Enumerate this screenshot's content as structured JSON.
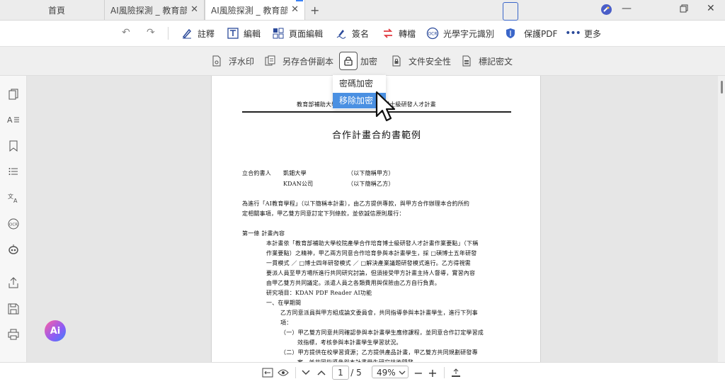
{
  "tabs": [
    {
      "label": "首頁"
    },
    {
      "label": "AI風險探測 _ 教育部補助..."
    },
    {
      "label": "AI風險探測 _ 教育部補助..."
    }
  ],
  "toolbar": {
    "annotate": "註釋",
    "edit": "編輯",
    "page_edit": "頁面編輯",
    "sign": "簽名",
    "convert": "轉檔",
    "ocr": "光學字元識別",
    "protect": "保護PDF",
    "more": "更多"
  },
  "subbar": {
    "watermark": "浮水印",
    "save_merge": "另存合併副本",
    "encrypt": "加密",
    "doc_security": "文件安全性",
    "redact": "標記密文"
  },
  "dropdown": {
    "items": [
      "密碼加密",
      "移除加密"
    ],
    "highlighted": "移除加密"
  },
  "document": {
    "header": "教育部補助大學校院產學合作培育博士級研發人才計畫",
    "title": "合作計畫合約書範例",
    "party_label": "立合約書人",
    "party1_name": "凱鈿大學",
    "party1_alias": "（以下簡稱甲方）",
    "party2_name": "KDAN公司",
    "party2_alias": "（以下簡稱乙方）",
    "intro_1": "為進行「AI教育學程」（以下簡稱本計畫），由乙方提供專款，與甲方合作辦理本合約所約",
    "intro_2": "定相關事項，甲乙雙方同意訂定下列條款，並依誠信原則履行：",
    "art1_title": "第一條  計畫內容",
    "art1_l1": "本計畫依「教育部補助大學校院產學合作培育博士級研發人才計畫作業要點」（下稱",
    "art1_l2": "作業要點）之精神，甲乙兩方同意合作培育參與本計畫學生，採 □碩博士五年研發",
    "art1_l3": "一貫模式 ／ □博士四年研發模式 ／ □解決產業議題研發模式進行。乙方得視需",
    "art1_l4": "要派人員至甲方場所進行共同研究討論，但須接受甲方計畫主持人督導，實習內容",
    "art1_l5": "由甲乙雙方共同議定。派遣人員之各類費用與保險由乙方自行負責。",
    "art1_project": "研究項目：KDAN PDF Reader AI功能",
    "sec1_title": "一、在學期間",
    "sec1_l1": "乙方同意派員與甲方組成論文委員會，共同指導參與本計畫學生，進行下列事",
    "sec1_l2": "項：",
    "item1_l1": "（一）甲乙雙方同意共同確認參與本計畫學生應修課程，並同意合作訂定學習成",
    "item1_l2": "效指標，考核參與本計畫學生學習狀況。",
    "item2_l1": "（二）甲方提供在校學習資源；乙方提供產品計畫，甲乙雙方共同規劃研發專",
    "item2_l2": "案，並共同指導參與本計畫學生研究技術開發。"
  },
  "bottombar": {
    "current_page": "1",
    "total_pages": "/ 5",
    "zoom": "49%"
  },
  "ai_button": "Ai",
  "colors": {
    "accent": "#4a90e2",
    "protect_blue": "#3a66c9",
    "convert_red": "#e0393e"
  }
}
